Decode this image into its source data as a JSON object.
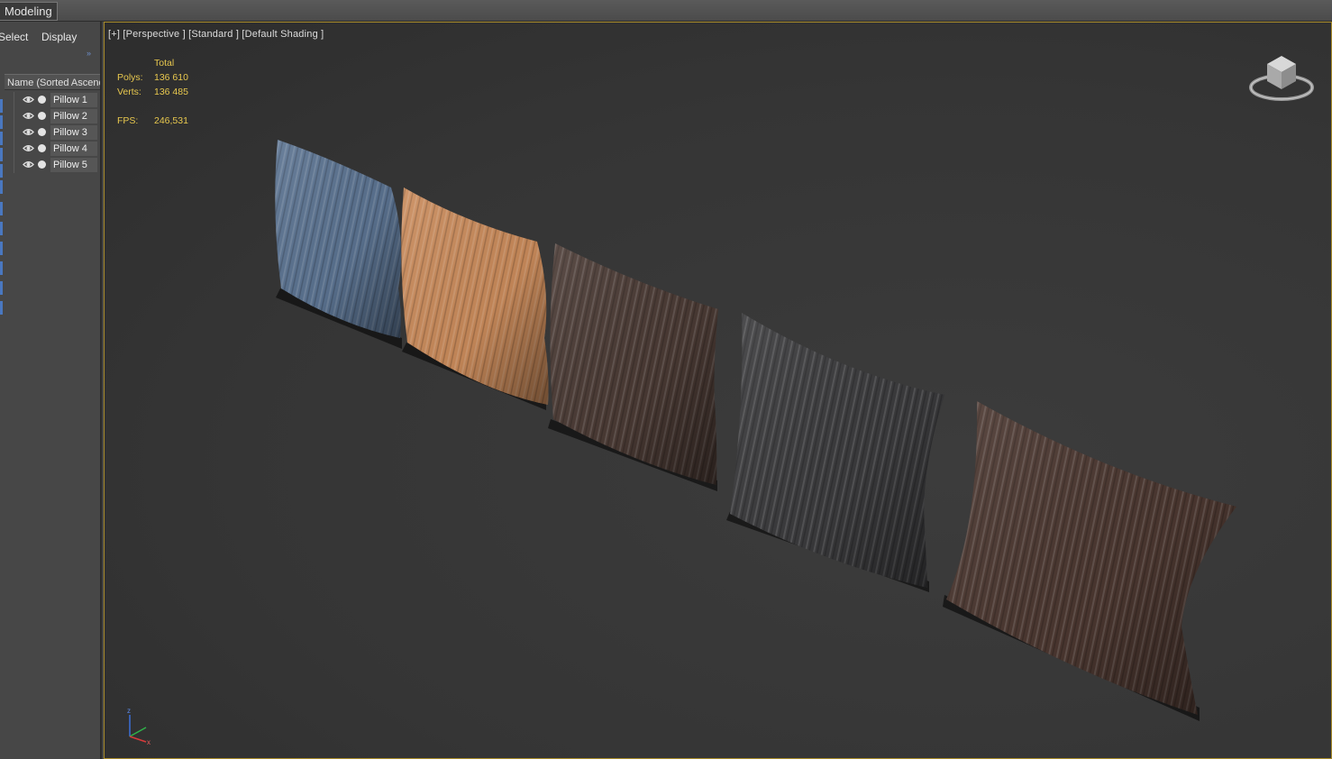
{
  "top_tab": "Modeling",
  "left_panel": {
    "menu": [
      "Select",
      "Display"
    ],
    "column_header": "Name (Sorted Ascending)",
    "items": [
      {
        "label": "Pillow 1"
      },
      {
        "label": "Pillow 2"
      },
      {
        "label": "Pillow 3"
      },
      {
        "label": "Pillow 4"
      },
      {
        "label": "Pillow 5"
      }
    ]
  },
  "viewport": {
    "label": "[+] [Perspective ] [Standard ] [Default Shading ]",
    "stats": {
      "header": "Total",
      "polys_label": "Polys:",
      "polys": "136 610",
      "verts_label": "Verts:",
      "verts": "136 485",
      "fps_label": "FPS:",
      "fps": "246,531"
    },
    "axis_labels": {
      "z": "z",
      "x": "x"
    }
  },
  "pillow_colors": [
    "#5a7290",
    "#c98a5a",
    "#4a3a34",
    "#3b3b3d",
    "#4b3730"
  ],
  "colors": {
    "stats_text": "#e8c84e",
    "viewport_border": "#a88b2a",
    "select_blue": "#4a78c0"
  }
}
